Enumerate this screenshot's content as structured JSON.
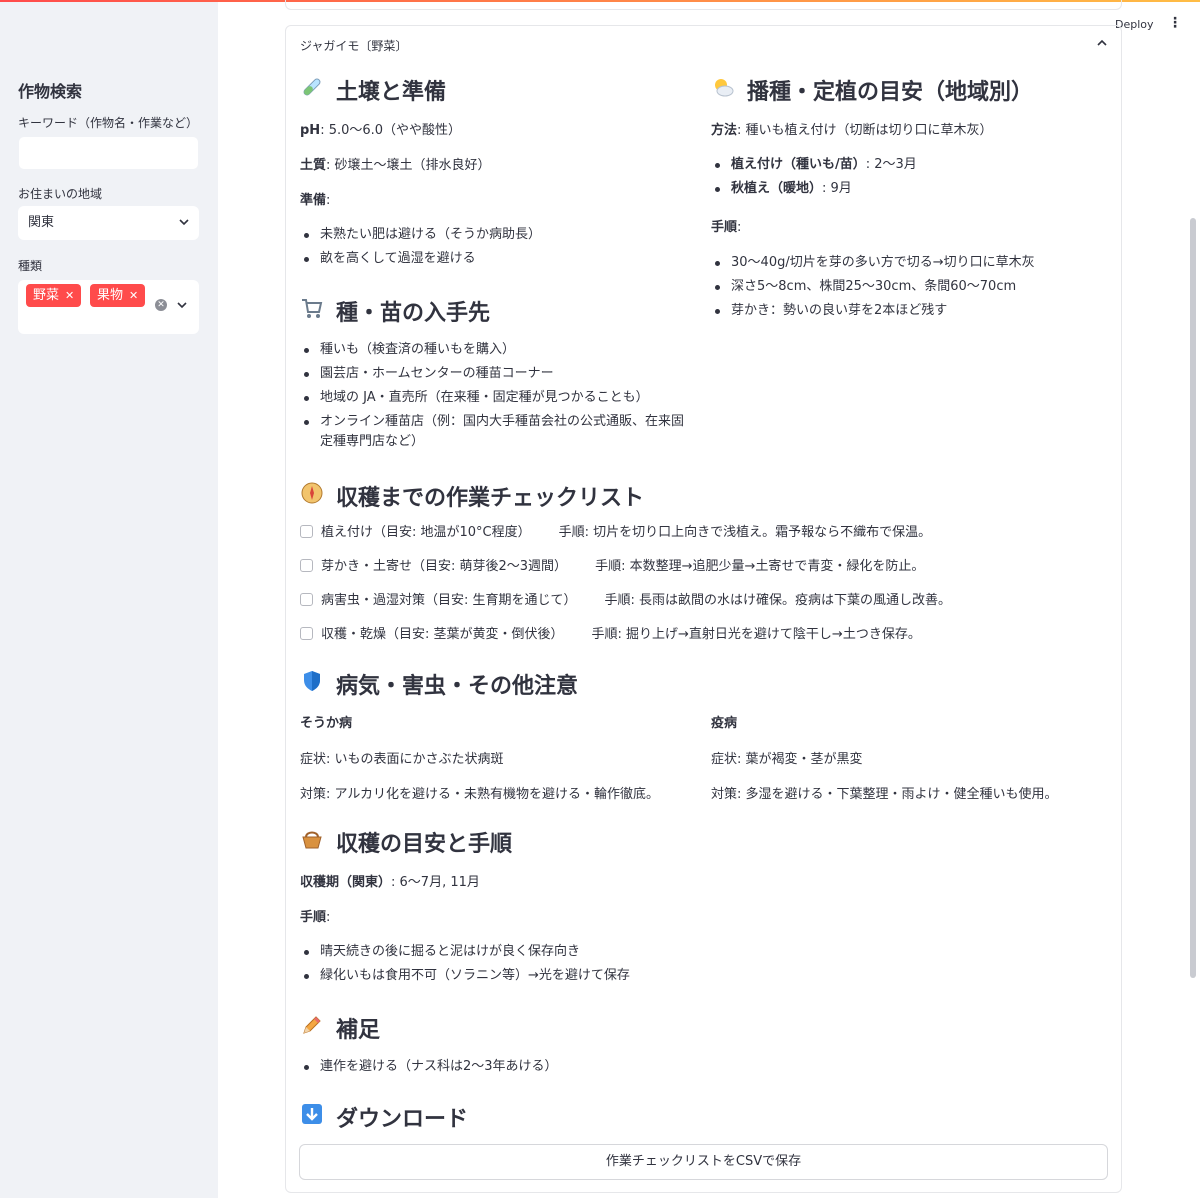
{
  "sidebar": {
    "title": "作物検索",
    "keyword_label": "キーワード（作物名・作業など）",
    "keyword_value": "",
    "region_label": "お住まいの地域",
    "region_value": "関東",
    "type_label": "種類",
    "type_tags": [
      "野菜",
      "果物"
    ]
  },
  "header": {
    "deploy_label": "Deploy"
  },
  "expander": {
    "title": "ジャガイモ〔野菜〕",
    "soil": {
      "heading_icon": "test-tube-icon",
      "heading": "土壌と準備",
      "ph_label": "pH",
      "ph_value": ": 5.0〜6.0（やや酸性）",
      "soil_label": "土質",
      "soil_value": ": 砂壌土〜壌土（排水良好）",
      "prep_label": "準備",
      "prep_colon": ":",
      "prep_items": [
        "未熟たい肥は避ける（そうか病助長）",
        "畝を高くして過湿を避ける"
      ]
    },
    "planting": {
      "heading_icon": "sun-cloud-icon",
      "heading": "播種・定植の目安（地域別）",
      "method_label": "方法",
      "method_value": ": 種いも植え付け（切断は切り口に草木灰）",
      "times": [
        {
          "label": "植え付け（種いも/苗）",
          "value": ": 2〜3月"
        },
        {
          "label": "秋植え（暖地）",
          "value": ": 9月"
        }
      ],
      "steps_label": "手順",
      "steps_colon": ":",
      "steps": [
        "30〜40g/切片を芽の多い方で切る→切り口に草木灰",
        "深さ5〜8cm、株間25〜30cm、条間60〜70cm",
        "芽かき：勢いの良い芽を2本ほど残す"
      ]
    },
    "sources": {
      "heading_icon": "shopping-cart-icon",
      "heading": "種・苗の入手先",
      "items": [
        "種いも（検査済の種いもを購入）",
        "園芸店・ホームセンターの種苗コーナー",
        "地域の JA・直売所（在来種・固定種が見つかることも）",
        "オンライン種苗店（例：国内大手種苗会社の公式通販、在来固定種専門店など）"
      ]
    },
    "checklist": {
      "heading_icon": "compass-icon",
      "heading": "収穫までの作業チェックリスト",
      "items": [
        {
          "task": "植え付け（目安: 地温が10°C程度）",
          "step": "手順: 切片を切り口上向きで浅植え。霜予報なら不織布で保温。"
        },
        {
          "task": "芽かき・土寄せ（目安: 萌芽後2〜3週間）",
          "step": "手順: 本数整理→追肥少量→土寄せで青変・緑化を防止。"
        },
        {
          "task": "病害虫・過湿対策（目安: 生育期を通じて）",
          "step": "手順: 長雨は畝間の水はけ確保。疫病は下葉の風通し改善。"
        },
        {
          "task": "収穫・乾燥（目安: 茎葉が黄変・倒伏後）",
          "step": "手順: 掘り上げ→直射日光を避けて陰干し→土つき保存。"
        }
      ]
    },
    "disease": {
      "heading_icon": "shield-icon",
      "heading": "病気・害虫・その他注意",
      "left": {
        "name": "そうか病",
        "symptom": "症状: いもの表面にかさぶた状病斑",
        "measure": "対策: アルカリ化を避ける・未熟有機物を避ける・輪作徹底。"
      },
      "right": {
        "name": "疫病",
        "symptom": "症状: 葉が褐変・茎が黒変",
        "measure": "対策: 多湿を避ける・下葉整理・雨よけ・健全種いも使用。"
      }
    },
    "harvest": {
      "heading_icon": "basket-icon",
      "heading": "収穫の目安と手順",
      "period_label": "収穫期（関東）",
      "period_value": ": 6〜7月, 11月",
      "steps_label": "手順",
      "steps_colon": ":",
      "steps": [
        "晴天続きの後に掘ると泥はけが良く保存向き",
        "緑化いもは食用不可（ソラニン等）→光を避けて保存"
      ]
    },
    "notes": {
      "heading_icon": "pencil-icon",
      "heading": "補足",
      "items": [
        "連作を避ける（ナス科は2〜3年あける）"
      ]
    },
    "download": {
      "heading_icon": "down-arrow-icon",
      "heading": "ダウンロード",
      "button_label": "作業チェックリストをCSVで保存"
    }
  }
}
